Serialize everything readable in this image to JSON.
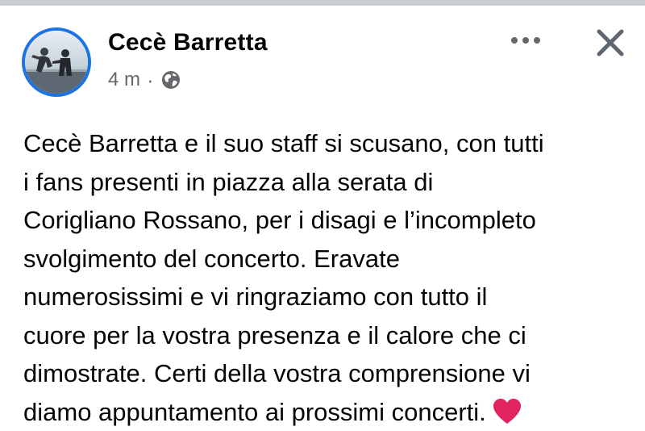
{
  "post": {
    "author": "Cecè Barretta",
    "timestamp": "4 m",
    "separator": "·",
    "privacy_icon": "globe-icon",
    "body_lines": [
      "Cecè Barretta e il suo staff si scusano, con tutti",
      "i fans presenti in piazza alla serata di",
      "Corigliano Rossano, per i disagi e l’incompleto",
      "svolgimento del concerto. Eravate",
      "numerosissimi e vi ringraziamo con tutto il",
      "cuore per la vostra presenza e il calore che ci",
      "dimostrate. Certi della vostra comprensione vi",
      "diamo appuntamento ai prossimi concerti."
    ],
    "trailing_emoji": "heart-emoji"
  },
  "actions": {
    "more_icon": "more-horizontal-icon",
    "close_icon": "close-icon"
  },
  "colors": {
    "avatar_ring": "#1b74e4",
    "meta_text": "#65676b",
    "heart": "#e0245e"
  }
}
